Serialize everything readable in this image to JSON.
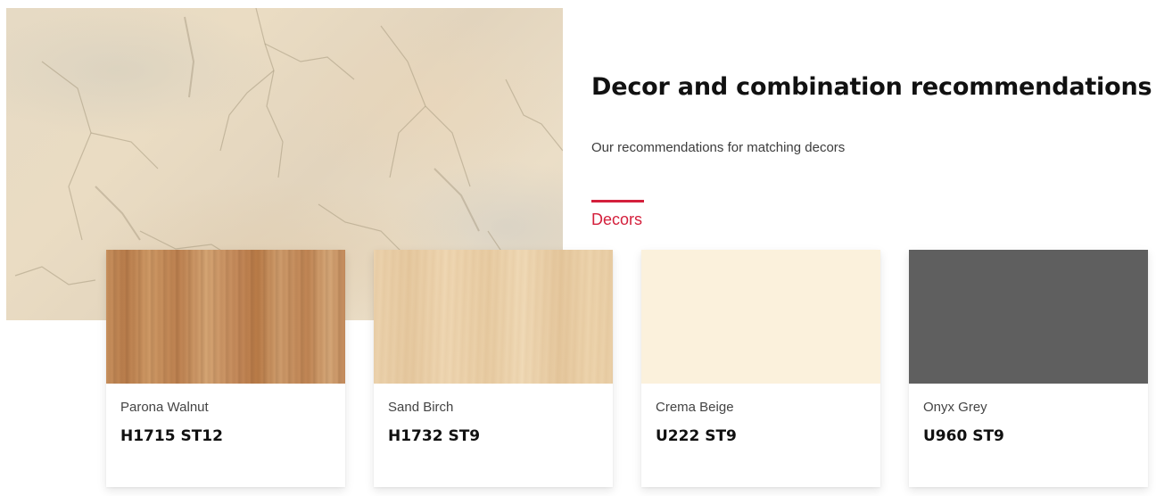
{
  "heading": {
    "title": "Decor and combination recommendations",
    "subtitle": "Our recommendations for matching decors"
  },
  "tabs": [
    {
      "label": "Decors",
      "active": true
    }
  ],
  "colors": {
    "accent": "#d4203c"
  },
  "cards": [
    {
      "name": "Parona Walnut",
      "code": "H1715 ST12",
      "swatch": "walnut-wood-texture"
    },
    {
      "name": "Sand Birch",
      "code": "H1732 ST9",
      "swatch": "birch-wood-texture"
    },
    {
      "name": "Crema Beige",
      "code": "U222 ST9",
      "swatch": "#fbf1dc"
    },
    {
      "name": "Onyx Grey",
      "code": "U960 ST9",
      "swatch": "#5f5f5f"
    }
  ]
}
